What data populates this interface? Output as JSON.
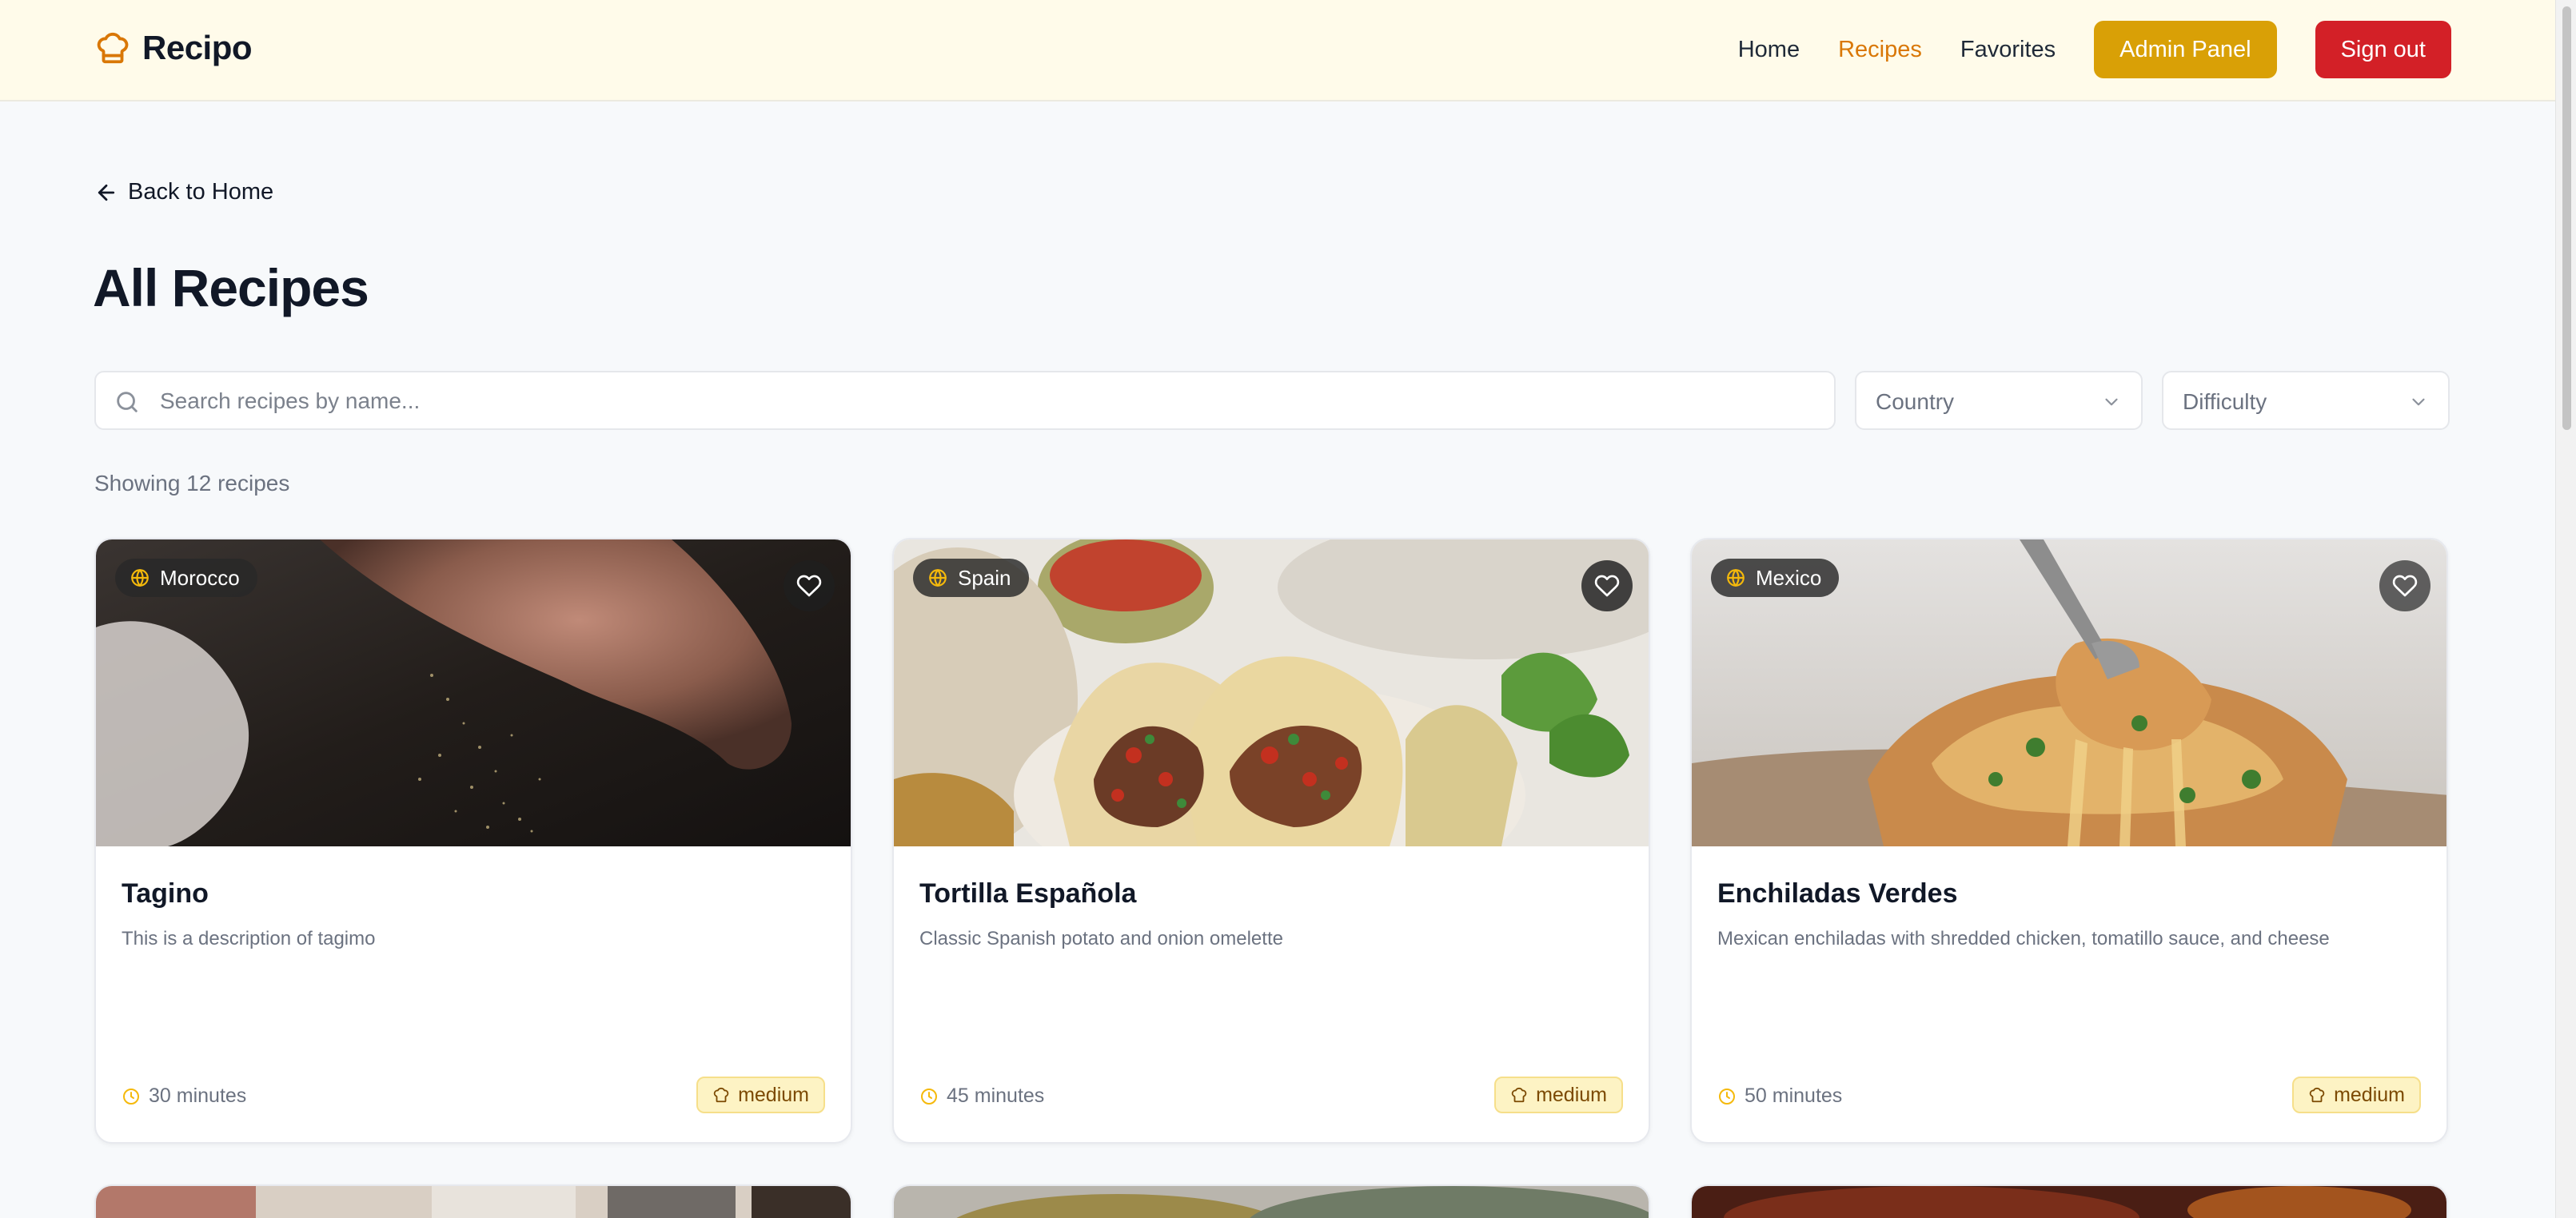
{
  "app": {
    "name": "Recipo"
  },
  "nav": {
    "items": [
      "Home",
      "Recipes",
      "Favorites"
    ],
    "active": "Recipes",
    "admin_label": "Admin Panel",
    "signout_label": "Sign out"
  },
  "colors": {
    "accent": "#d97706",
    "admin_button": "#d9a006",
    "signout_button": "#d32027",
    "header_bg": "#fffbea",
    "difficulty_badge_bg": "#fdf3c4"
  },
  "back_label": "Back to Home",
  "page_title": "All Recipes",
  "search": {
    "placeholder": "Search recipes by name...",
    "value": ""
  },
  "filters": {
    "country": "Country",
    "difficulty": "Difficulty"
  },
  "showing": "Showing 12 recipes",
  "recipes": [
    {
      "title": "Tagino",
      "country": "Morocco",
      "description": "This is a description of tagimo",
      "time": "30 minutes",
      "difficulty": "medium"
    },
    {
      "title": "Tortilla Española",
      "country": "Spain",
      "description": "Classic Spanish potato and onion omelette",
      "time": "45 minutes",
      "difficulty": "medium"
    },
    {
      "title": "Enchiladas Verdes",
      "country": "Mexico",
      "description": "Mexican enchiladas with shredded chicken, tomatillo sauce, and cheese",
      "time": "50 minutes",
      "difficulty": "medium"
    }
  ],
  "icons": {
    "logo": "chef-hat-icon",
    "back": "arrow-left-icon",
    "search": "search-icon",
    "dropdown": "chevron-down-icon",
    "country": "globe-icon",
    "favorite": "heart-icon",
    "time": "clock-icon",
    "difficulty": "chef-hat-icon"
  }
}
